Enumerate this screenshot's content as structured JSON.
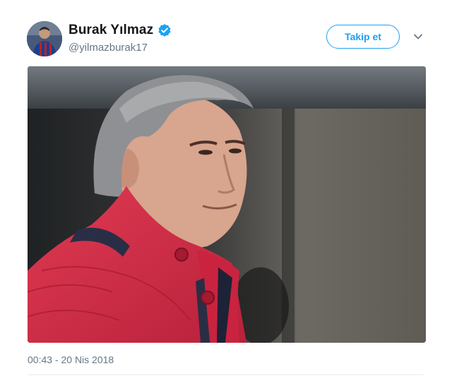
{
  "user": {
    "display_name": "Burak Yılmaz",
    "handle": "@yilmazburak17",
    "verified": true,
    "avatar_icon": "avatar-photo"
  },
  "follow_button": {
    "label": "Takip et"
  },
  "menu": {
    "icon": "chevron-down-icon"
  },
  "media": {
    "description_icon": "photo-man-red-jacket"
  },
  "timestamp": "00:43 - 20 Nis 2018",
  "colors": {
    "accent": "#1da1f2",
    "secondary_text": "#657786",
    "primary_text": "#14171a",
    "divider": "#e6ecf0"
  }
}
